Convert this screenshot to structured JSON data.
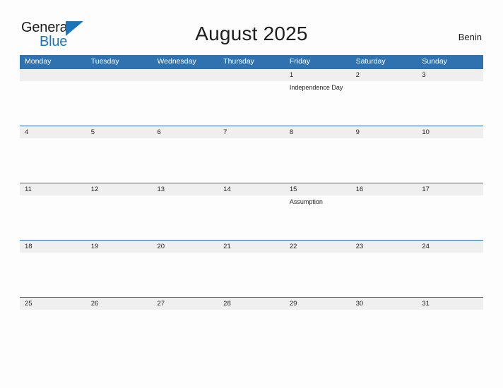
{
  "brand": {
    "name_top": "General",
    "name_bottom": "Blue",
    "triangle_icon": "triangle-icon",
    "accent_color": "#1c74bb"
  },
  "header": {
    "title": "August 2025",
    "locale": "Benin"
  },
  "calendar": {
    "header_color": "#3071b0",
    "daynum_band_color": "#efefef",
    "weekdays": [
      "Monday",
      "Tuesday",
      "Wednesday",
      "Thursday",
      "Friday",
      "Saturday",
      "Sunday"
    ],
    "weeks": [
      {
        "days": [
          {
            "num": "",
            "event": ""
          },
          {
            "num": "",
            "event": ""
          },
          {
            "num": "",
            "event": ""
          },
          {
            "num": "",
            "event": ""
          },
          {
            "num": "1",
            "event": "Independence Day"
          },
          {
            "num": "2",
            "event": ""
          },
          {
            "num": "3",
            "event": ""
          }
        ]
      },
      {
        "days": [
          {
            "num": "4",
            "event": ""
          },
          {
            "num": "5",
            "event": ""
          },
          {
            "num": "6",
            "event": ""
          },
          {
            "num": "7",
            "event": ""
          },
          {
            "num": "8",
            "event": ""
          },
          {
            "num": "9",
            "event": ""
          },
          {
            "num": "10",
            "event": ""
          }
        ]
      },
      {
        "days": [
          {
            "num": "11",
            "event": ""
          },
          {
            "num": "12",
            "event": ""
          },
          {
            "num": "13",
            "event": ""
          },
          {
            "num": "14",
            "event": ""
          },
          {
            "num": "15",
            "event": "Assumption"
          },
          {
            "num": "16",
            "event": ""
          },
          {
            "num": "17",
            "event": ""
          }
        ]
      },
      {
        "days": [
          {
            "num": "18",
            "event": ""
          },
          {
            "num": "19",
            "event": ""
          },
          {
            "num": "20",
            "event": ""
          },
          {
            "num": "21",
            "event": ""
          },
          {
            "num": "22",
            "event": ""
          },
          {
            "num": "23",
            "event": ""
          },
          {
            "num": "24",
            "event": ""
          }
        ]
      },
      {
        "days": [
          {
            "num": "25",
            "event": ""
          },
          {
            "num": "26",
            "event": ""
          },
          {
            "num": "27",
            "event": ""
          },
          {
            "num": "28",
            "event": ""
          },
          {
            "num": "29",
            "event": ""
          },
          {
            "num": "30",
            "event": ""
          },
          {
            "num": "31",
            "event": ""
          }
        ]
      }
    ]
  }
}
